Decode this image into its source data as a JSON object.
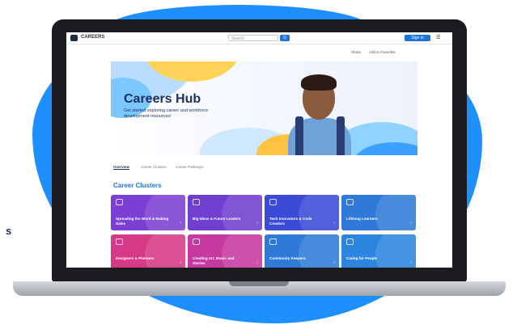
{
  "header": {
    "brand": "CAREERS",
    "search_placeholder": "Search",
    "search_button": "Q",
    "signin_button": "Sign in",
    "menu": "☰"
  },
  "util": {
    "share": "Share",
    "favorite": "Add to Favorites"
  },
  "hero": {
    "title": "Careers Hub",
    "subtitle": "Get started exploring career and workforce development resources!"
  },
  "tabs": [
    "Overview",
    "Career Clusters",
    "Career Pathways"
  ],
  "section_title": "Career Clusters",
  "cards": [
    {
      "label": "Spreading the Word & Making Sales",
      "color": "#7b3fd3"
    },
    {
      "label": "Big Ideas & Future Leaders",
      "color": "#6f3fcf"
    },
    {
      "label": "Tech Innovators & Code Creators",
      "color": "#3b4bd6"
    },
    {
      "label": "Lifelong Learners",
      "color": "#2f7ad8"
    },
    {
      "label": "Designers & Planners",
      "color": "#d63a86"
    },
    {
      "label": "Creating Art, Music and Stories",
      "color": "#c63aa0"
    },
    {
      "label": "Community Keepers",
      "color": "#2f7ad8"
    },
    {
      "label": "Caring for People",
      "color": "#2c86e0"
    }
  ],
  "edge_glyph": "s",
  "colors": {
    "accent": "#1e8fff",
    "primary": "#1e73d8",
    "navy": "#1d2f5e"
  },
  "icons": [
    "search-icon",
    "menu-icon",
    "cluster-icon"
  ]
}
